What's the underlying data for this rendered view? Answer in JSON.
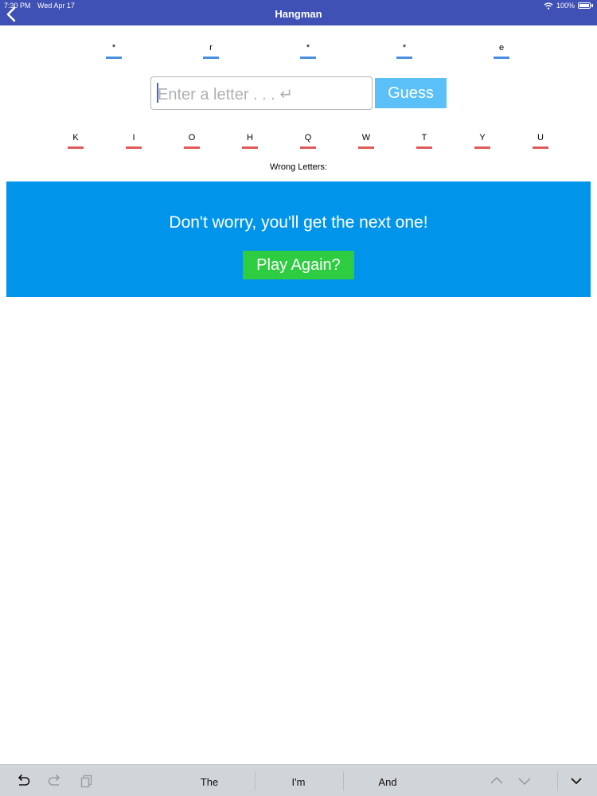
{
  "status_bar": {
    "time": "7:30 PM",
    "date": "Wed Apr 17",
    "battery": "100%"
  },
  "nav": {
    "title": "Hangman",
    "back_icon": "chevron-left-icon"
  },
  "word_slots": [
    "*",
    "r",
    "*",
    "*",
    "e"
  ],
  "input": {
    "placeholder": "Enter a letter . . . ↵",
    "value": ""
  },
  "guess_button": "Guess",
  "wrong_letters": [
    "K",
    "I",
    "O",
    "H",
    "Q",
    "W",
    "T",
    "Y",
    "U"
  ],
  "wrong_label": "Wrong Letters:",
  "result": {
    "message": "Don't worry, you'll get the next one!",
    "play_again": "Play Again?"
  },
  "keyboard_bar": {
    "suggestions": [
      "The",
      "I'm",
      "And"
    ],
    "icons": [
      "undo-icon",
      "redo-icon",
      "paste-icon",
      "chevron-up-icon",
      "chevron-down-icon",
      "dismiss-keyboard-icon"
    ]
  },
  "colors": {
    "nav_bg": "#3f51b5",
    "word_underline": "#4a90e2",
    "wrong_underline": "#e05a5a",
    "panel_bg": "#0095eb",
    "guess_bg": "#5bc0f8",
    "play_bg": "#2ecc40"
  }
}
